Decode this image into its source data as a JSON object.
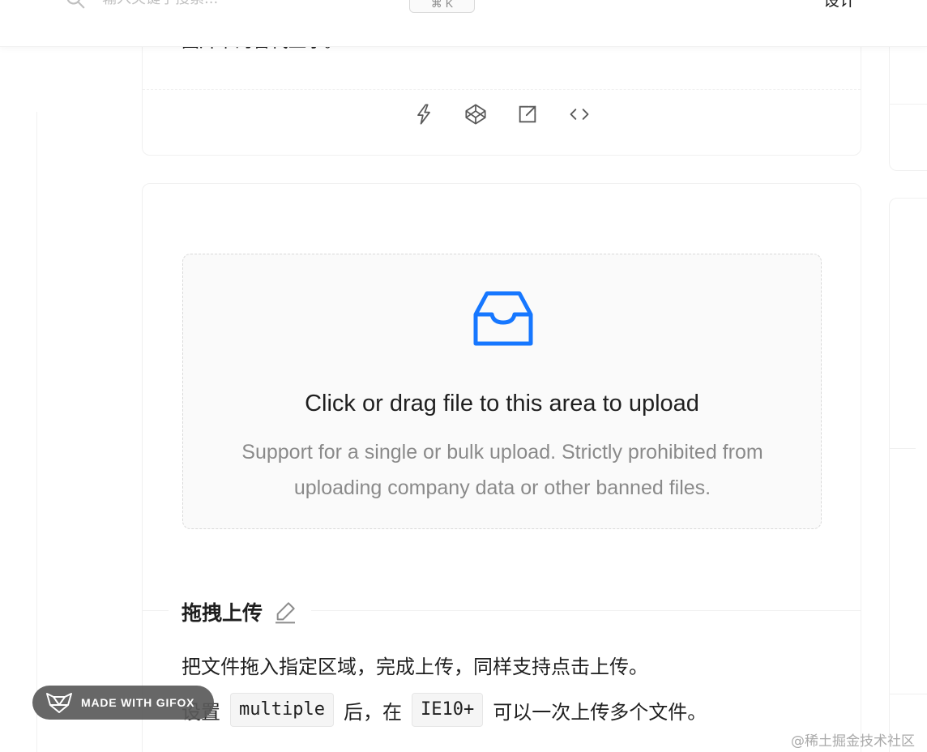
{
  "header": {
    "search_placeholder": "输入关键字搜索...",
    "shortcut": "⌘ K",
    "nav_link": "设计"
  },
  "prev_card": {
    "description_tail": "图片下的替代显示。",
    "actions": [
      {
        "icon": "thunderbolt-icon",
        "label": "Codesandbox"
      },
      {
        "icon": "codepen-icon",
        "label": "CodePen"
      },
      {
        "icon": "external-link-icon",
        "label": "Open in new window"
      },
      {
        "icon": "code-icon",
        "label": "Show code"
      }
    ]
  },
  "dragger": {
    "icon": "inbox-icon",
    "text": "Click or drag file to this area to upload",
    "hint": "Support for a single or bulk upload. Strictly prohibited from uploading company data or other banned files."
  },
  "demo_meta": {
    "title": "拖拽上传",
    "line1": "把文件拖入指定区域，完成上传，同样支持点击上传。",
    "line2_a": "设置",
    "code1": "multiple",
    "line2_b": "后，在",
    "code2": "IE10+",
    "line2_c": "可以一次上传多个文件。"
  },
  "badge": {
    "text": "MADE WITH GIFOX"
  },
  "watermark": "@稀土掘金技术社区",
  "colors": {
    "primary": "#1677ff",
    "border": "#f0f0f0",
    "dragger_bg": "#fafafa"
  }
}
